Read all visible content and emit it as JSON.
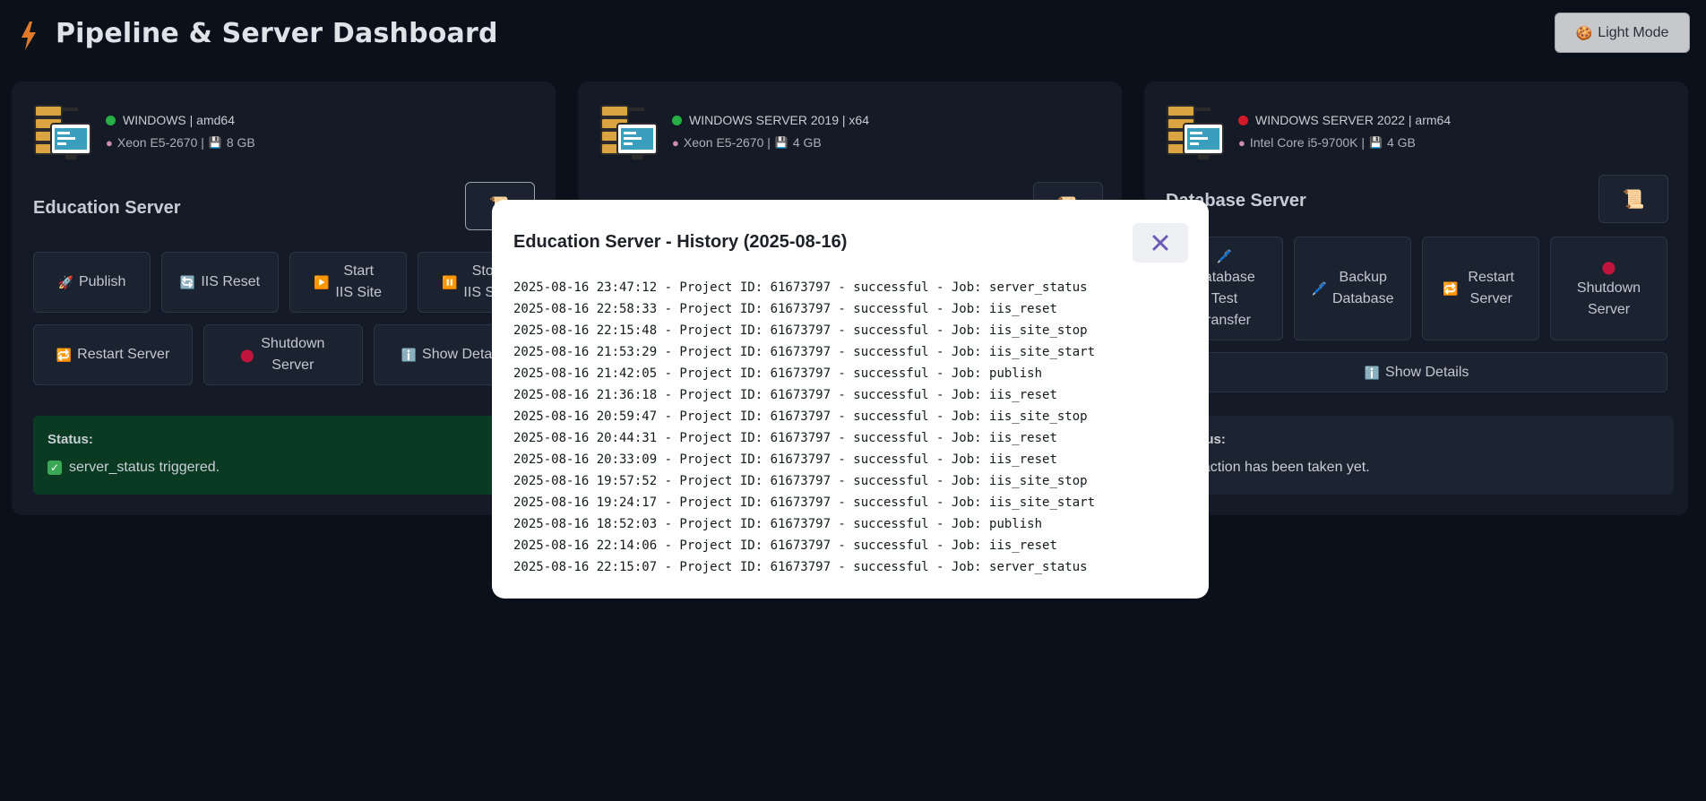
{
  "app": {
    "title": "Pipeline & Server Dashboard",
    "theme_toggle": "Light Mode",
    "bolt_icon": "lightning-bolt-icon"
  },
  "colors": {
    "background": "#0b111b",
    "card": "#141b26",
    "online": "#27ae45",
    "offline": "#d11a2a",
    "status_success_bg": "#0a3a22"
  },
  "servers": [
    {
      "os": "WINDOWS | amd64",
      "online": true,
      "cpu": "Xeon E5-2670 |",
      "ram": "8 GB",
      "name": "Education Server",
      "actions": [
        "Publish",
        "IIS Reset",
        "Start IIS Site",
        "Stop IIS Site",
        "Restart Server",
        "Shutdown Server",
        "Show Details"
      ],
      "status_label": "Status:",
      "status_message": "server_status triggered."
    },
    {
      "os": "WINDOWS SERVER 2019 | x64",
      "online": true,
      "cpu": "Xeon E5-2670 |",
      "ram": "4 GB"
    },
    {
      "os": "WINDOWS SERVER 2022 | arm64",
      "online": false,
      "cpu": "Intel Core i5-9700K |",
      "ram": "4 GB",
      "name": "Database Server",
      "actions": [
        "Database Test Transfer",
        "Backup Database",
        "Restart Server",
        "Shutdown Server",
        "Show Details"
      ],
      "status_label": "Status:",
      "status_message": "No action has been taken yet."
    }
  ],
  "modal": {
    "title": "Education Server - History (2025-08-16)",
    "close_icon": "close-icon",
    "entries": [
      "2025-08-16 23:47:12 - Project ID: 61673797 - successful - Job: server_status",
      "2025-08-16 22:58:33 - Project ID: 61673797 - successful - Job: iis_reset",
      "2025-08-16 22:15:48 - Project ID: 61673797 - successful - Job: iis_site_stop",
      "2025-08-16 21:53:29 - Project ID: 61673797 - successful - Job: iis_site_start",
      "2025-08-16 21:42:05 - Project ID: 61673797 - successful - Job: publish",
      "2025-08-16 21:36:18 - Project ID: 61673797 - successful - Job: iis_reset",
      "2025-08-16 20:59:47 - Project ID: 61673797 - successful - Job: iis_site_stop",
      "2025-08-16 20:44:31 - Project ID: 61673797 - successful - Job: iis_reset",
      "2025-08-16 20:33:09 - Project ID: 61673797 - successful - Job: iis_reset",
      "2025-08-16 19:57:52 - Project ID: 61673797 - successful - Job: iis_site_stop",
      "2025-08-16 19:24:17 - Project ID: 61673797 - successful - Job: iis_site_start",
      "2025-08-16 18:52:03 - Project ID: 61673797 - successful - Job: publish",
      "2025-08-16 22:14:06 - Project ID: 61673797 - successful - Job: iis_reset",
      "2025-08-16 22:15:07 - Project ID: 61673797 - successful - Job: server_status"
    ]
  }
}
